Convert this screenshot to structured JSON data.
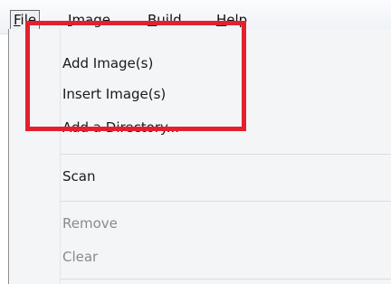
{
  "menubar": {
    "file": {
      "accel": "F",
      "rest": "ile"
    },
    "image": {
      "accel": "I",
      "rest": "mage"
    },
    "build": {
      "accel": "B",
      "rest": "uild"
    },
    "help": {
      "accel": "H",
      "rest": "elp"
    }
  },
  "file_menu": {
    "items": [
      {
        "label": "Add Image(s)",
        "enabled": true
      },
      {
        "label": "Insert Image(s)",
        "enabled": true
      },
      {
        "label": "Add a Directory...",
        "enabled": true
      },
      {
        "label": "Scan",
        "enabled": true
      },
      {
        "label": "Remove",
        "enabled": false
      },
      {
        "label": "Clear",
        "enabled": false
      }
    ]
  },
  "colors": {
    "highlight": "#e3202e",
    "disabled_text": "#8a8a8a"
  }
}
